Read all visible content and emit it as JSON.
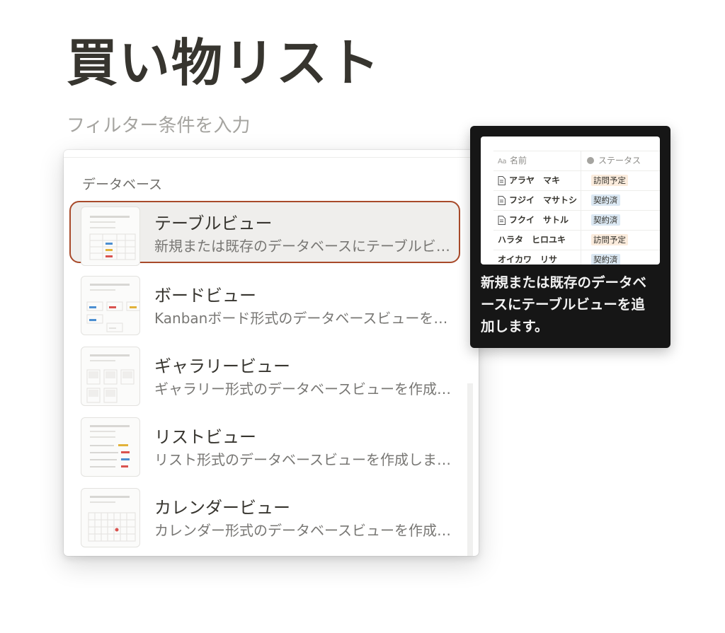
{
  "page": {
    "title": "買い物リスト",
    "filter_placeholder": "フィルター条件を入力"
  },
  "menu": {
    "section_label": "データベース",
    "items": [
      {
        "title": "テーブルビュー",
        "description": "新規または既存のデータベースにテーブルビューを追加します。",
        "icon": "table-view-thumbnail",
        "selected": true
      },
      {
        "title": "ボードビュー",
        "description": "Kanbanボード形式のデータベースビューを作成します。",
        "icon": "board-view-thumbnail",
        "selected": false
      },
      {
        "title": "ギャラリービュー",
        "description": "ギャラリー形式のデータベースビューを作成します。",
        "icon": "gallery-view-thumbnail",
        "selected": false
      },
      {
        "title": "リストビュー",
        "description": "リスト形式のデータベースビューを作成します。",
        "icon": "list-view-thumbnail",
        "selected": false
      },
      {
        "title": "カレンダービュー",
        "description": "カレンダー形式のデータベースビューを作成します。",
        "icon": "calendar-view-thumbnail",
        "selected": false
      }
    ]
  },
  "tooltip": {
    "preview": {
      "columns": [
        "名前",
        "ステータス"
      ],
      "name_icon": "Aa",
      "rows": [
        {
          "name": "アラヤ　マキ",
          "status": "訪問予定",
          "status_color": "orange",
          "has_doc_icon": true
        },
        {
          "name": "フジイ　マサトシ",
          "status": "契約済",
          "status_color": "blue",
          "has_doc_icon": true
        },
        {
          "name": "フクイ　サトル",
          "status": "契約済",
          "status_color": "blue",
          "has_doc_icon": true
        },
        {
          "name": "ハラタ　ヒロユキ",
          "status": "訪問予定",
          "status_color": "orange",
          "has_doc_icon": false
        },
        {
          "name": "オイカワ　リサ",
          "status": "契約済",
          "status_color": "blue",
          "has_doc_icon": false
        }
      ]
    },
    "text": "新規または既存のデータベースにテーブルビューを追加します。"
  },
  "colors": {
    "title_text": "#37352f",
    "selected_border": "#a84a2a",
    "tooltip_bg": "#161616",
    "tag_orange": "#fbecdd",
    "tag_blue": "#dbe8f3"
  }
}
